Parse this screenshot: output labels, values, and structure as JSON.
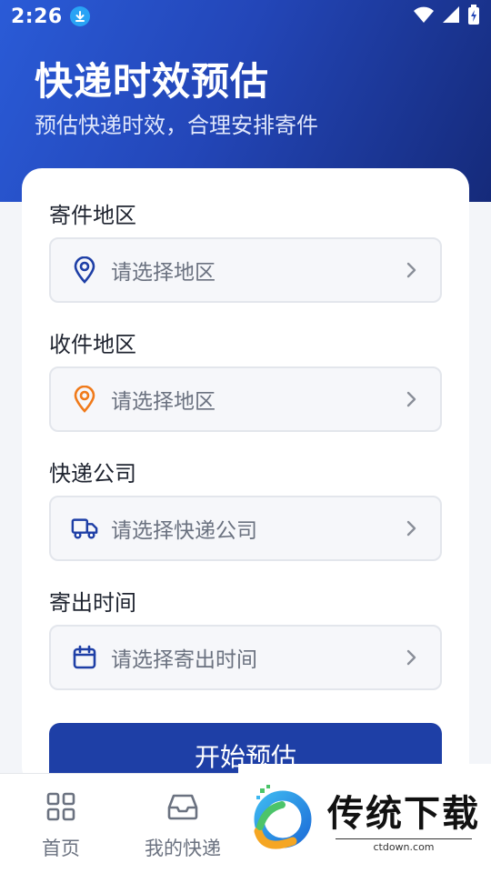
{
  "status_bar": {
    "time": "2:26"
  },
  "header": {
    "title": "快递时效预估",
    "subtitle": "预估快递时效，合理安排寄件"
  },
  "form": {
    "fields": [
      {
        "label": "寄件地区",
        "placeholder": "请选择地区",
        "icon": "location-pin-icon",
        "icon_color": "#1e3fa6"
      },
      {
        "label": "收件地区",
        "placeholder": "请选择地区",
        "icon": "location-pin-icon",
        "icon_color": "#f07a1a"
      },
      {
        "label": "快递公司",
        "placeholder": "请选择快递公司",
        "icon": "truck-icon",
        "icon_color": "#1e3fa6"
      },
      {
        "label": "寄出时间",
        "placeholder": "请选择寄出时间",
        "icon": "calendar-icon",
        "icon_color": "#1e3fa6"
      }
    ],
    "submit_label": "开始预估"
  },
  "tabbar": {
    "items": [
      {
        "label": "首页",
        "icon": "grid-icon"
      },
      {
        "label": "我的快递",
        "icon": "inbox-icon"
      }
    ]
  },
  "watermark": {
    "title": "传统下载",
    "url": "ctdown.com"
  },
  "colors": {
    "primary": "#1e3fa6",
    "accent_orange": "#f07a1a",
    "hero_start": "#2a5bd7",
    "hero_end": "#152a7a"
  }
}
